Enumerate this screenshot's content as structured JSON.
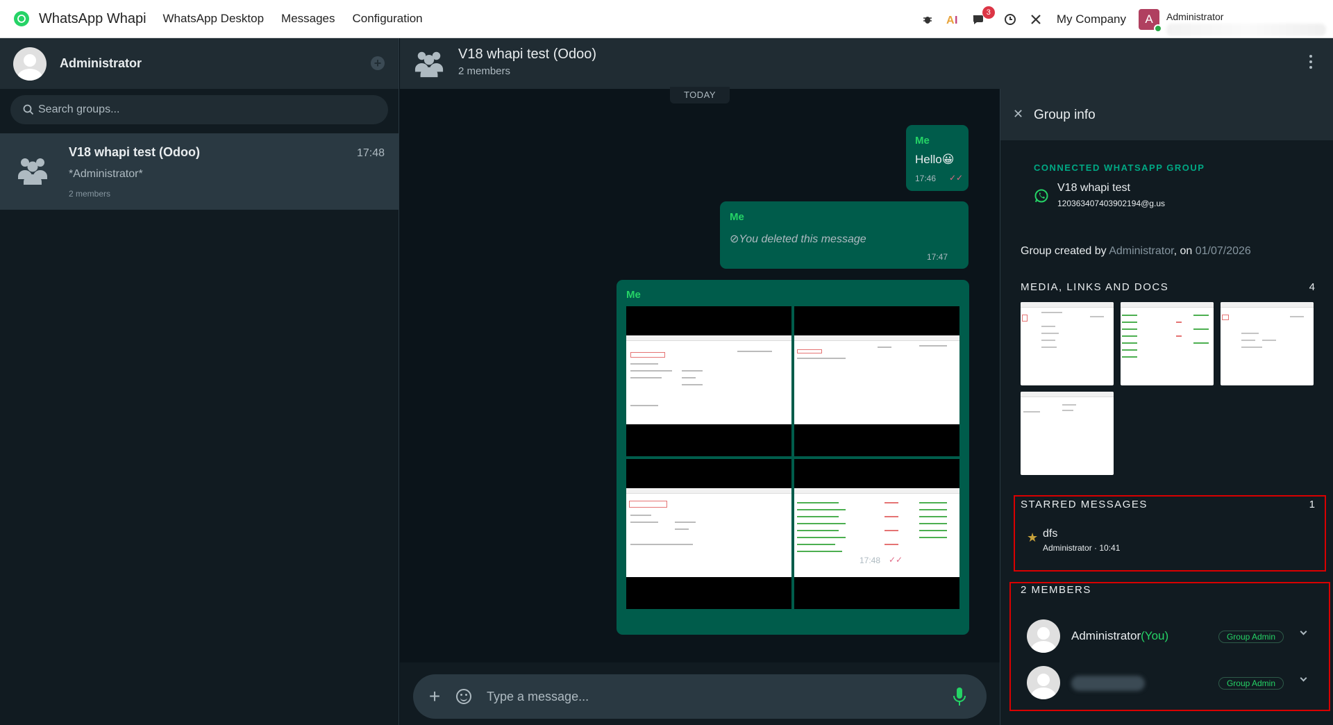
{
  "topbar": {
    "app_name": "WhatsApp Whapi",
    "nav": [
      "WhatsApp Desktop",
      "Messages",
      "Configuration"
    ],
    "icons": [
      "bug-icon",
      "ai-icon",
      "chat-icon",
      "clock-icon",
      "tools-icon"
    ],
    "chat_badge": "3",
    "company": "My Company",
    "user_initial": "A",
    "user_name": "Administrator"
  },
  "sidebar": {
    "user_name": "Administrator",
    "search_placeholder": "Search groups...",
    "chats": [
      {
        "title": "V18 whapi test (Odoo)",
        "time": "17:48",
        "last_message": "*Administrator*",
        "meta": "2 members"
      }
    ]
  },
  "chat": {
    "title": "V18 whapi test (Odoo)",
    "subtitle": "2 members",
    "date_divider": "TODAY",
    "messages": [
      {
        "sender": "Me",
        "text": "Hello😀",
        "time": "17:46"
      },
      {
        "sender": "Me",
        "text": "⊘You deleted this message",
        "time": "17:47"
      },
      {
        "sender": "Me",
        "text": "",
        "time": "17:48"
      }
    ],
    "composer_placeholder": "Type a message..."
  },
  "group_info": {
    "title": "Group info",
    "connected_label": "CONNECTED WHATSAPP GROUP",
    "connected_name": "V18 whapi test",
    "connected_id": "120363407403902194@g.us",
    "created_prefix": "Group created by ",
    "created_by": "Administrator",
    "created_mid": ", on ",
    "created_date": "01/07/2026",
    "media_label": "MEDIA, LINKS AND DOCS",
    "media_count": "4",
    "starred_label": "STARRED MESSAGES",
    "starred_count": "1",
    "starred": [
      {
        "text": "dfs",
        "meta": "Administrator · 10:41"
      }
    ],
    "members_label": "2 MEMBERS",
    "members": [
      {
        "name": "Administrator",
        "you": "(You)",
        "role": "Group Admin"
      },
      {
        "name": "",
        "you": "",
        "role": "Group Admin"
      }
    ]
  },
  "colors": {
    "accent": "#25d366",
    "bubble": "#005c4b",
    "panel": "#202c33",
    "background": "#0b141a",
    "highlight": "#d90000"
  }
}
